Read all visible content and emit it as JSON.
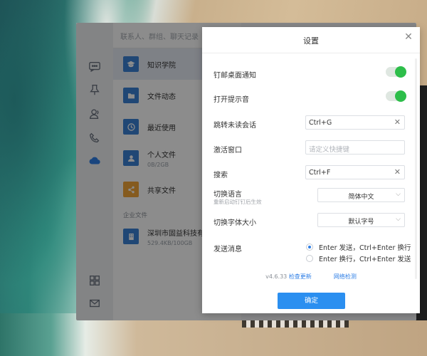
{
  "app": {
    "search_placeholder": "联系人、群组、聊天记录",
    "list": [
      {
        "title": "知识学院",
        "sub": "",
        "icon": "graduation-cap-icon",
        "color": "#3b82d6"
      },
      {
        "title": "文件动态",
        "sub": "",
        "icon": "folder-icon",
        "color": "#3b82d6"
      },
      {
        "title": "最近使用",
        "sub": "",
        "icon": "clock-icon",
        "color": "#3b82d6"
      },
      {
        "title": "个人文件",
        "sub": "0B/2GB",
        "icon": "person-icon",
        "color": "#3b82d6"
      },
      {
        "title": "共享文件",
        "sub": "",
        "icon": "share-icon",
        "color": "#f2a73a"
      }
    ],
    "section_label": "企业文件",
    "enterprise_item": {
      "title": "深圳市固益科技有",
      "sub": "529.4KB/100GB",
      "icon": "building-icon",
      "color": "#3b82d6"
    }
  },
  "dialog": {
    "title": "设置",
    "settings": {
      "ding_notify": {
        "label": "钉邮桌面通知",
        "on": true
      },
      "sound": {
        "label": "打开提示音",
        "on": true
      },
      "jump_unread": {
        "label": "跳转未读会话",
        "value": "Ctrl+G"
      },
      "activate_window": {
        "label": "激活窗口",
        "placeholder": "请定义快捷键"
      },
      "search": {
        "label": "搜索",
        "value": "Ctrl+F"
      },
      "language": {
        "label": "切换语言",
        "sublabel": "重新启动钉钉后生效",
        "value": "简体中文"
      },
      "font_size": {
        "label": "切换字体大小",
        "value": "默认字号"
      },
      "send_message": {
        "label": "发送消息",
        "options": [
          "Enter 发送，Ctrl+Enter 换行",
          "Enter 换行，Ctrl+Enter 发送"
        ],
        "selected": 0
      }
    },
    "version": "v4.6.33",
    "check_update": "检查更新",
    "network_check": "网络检测",
    "confirm": "确定"
  },
  "colors": {
    "accent": "#2b8ff0",
    "toggle_on": "#2dbe4a"
  }
}
